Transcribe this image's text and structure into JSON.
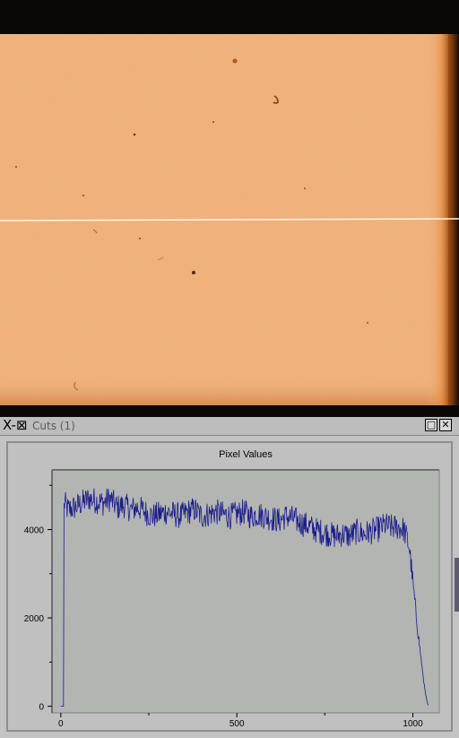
{
  "window": {
    "logo": "X-⊠",
    "title": "Cuts (1)",
    "maximize_label": "□",
    "close_label": "✕"
  },
  "colors": {
    "plot_line": "#1a1a8c",
    "plot_background": "#b3b5b3",
    "window_background": "#c3c3c3",
    "image_orange": "#f5b47e",
    "image_dark_edge": "#0b0704"
  },
  "chart_data": {
    "type": "line",
    "title": "Pixel Values",
    "xlabel": "",
    "ylabel": "",
    "xlim": [
      -25,
      1075
    ],
    "ylim": [
      -150,
      5350
    ],
    "x_ticks": [
      0,
      500,
      1000
    ],
    "y_ticks": [
      0,
      2000,
      4000
    ],
    "x_tick_labels": [
      "0",
      "500",
      "1000"
    ],
    "y_tick_labels": [
      "0",
      "2000",
      "4000"
    ],
    "grid": false,
    "series": [
      {
        "x": [
          0,
          5,
          8,
          9,
          10,
          20,
          40,
          60,
          80,
          100,
          120,
          140,
          160,
          180,
          200,
          220,
          240,
          260,
          280,
          300,
          320,
          340,
          360,
          380,
          400,
          420,
          440,
          460,
          480,
          500,
          520,
          540,
          560,
          580,
          600,
          620,
          640,
          660,
          680,
          700,
          720,
          740,
          760,
          780,
          800,
          820,
          840,
          860,
          880,
          900,
          920,
          940,
          960,
          975,
          990,
          1000,
          1010,
          1020,
          1030,
          1040,
          1045
        ],
        "values": [
          0,
          0,
          0,
          4500,
          4600,
          4450,
          4500,
          4600,
          4700,
          4650,
          4600,
          4700,
          4500,
          4550,
          4450,
          4500,
          4400,
          4300,
          4350,
          4400,
          4350,
          4300,
          4400,
          4450,
          4300,
          4350,
          4400,
          4350,
          4300,
          4350,
          4400,
          4300,
          4350,
          4300,
          4250,
          4200,
          4300,
          4250,
          4150,
          4100,
          4000,
          3950,
          3900,
          3850,
          3900,
          3850,
          3950,
          3900,
          3950,
          4000,
          4100,
          4050,
          4050,
          4000,
          3600,
          2800,
          2000,
          1300,
          600,
          100,
          0
        ]
      }
    ]
  }
}
